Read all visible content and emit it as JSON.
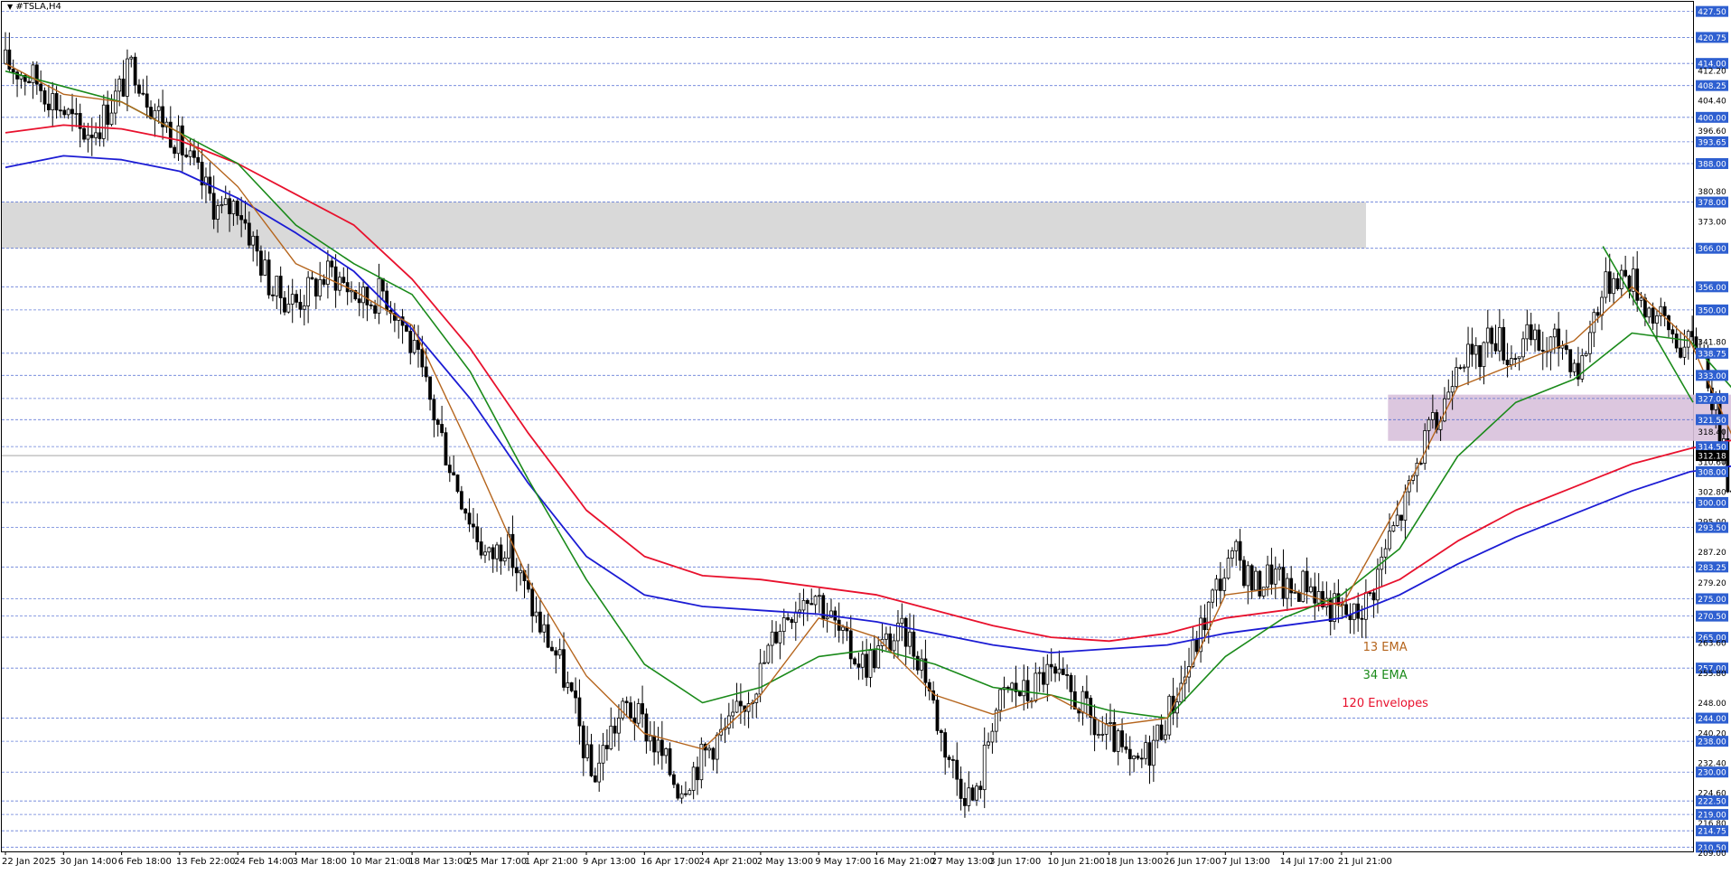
{
  "window": {
    "symbol_title": "#TSLA,H4",
    "current_price": "312.18"
  },
  "colors": {
    "background": "#ffffff",
    "bull_body": "#ffffff",
    "bear_body": "#000000",
    "candle_outline": "#000000",
    "ema13": "#b5651d",
    "ema34": "#1a8a1a",
    "env_upper": "#e8112d",
    "env_lower": "#1c1cd4",
    "trendline": "#1a8a1a",
    "resistance_zone": "#d9d9d9",
    "pivot_zone": "#d8c1dc",
    "level_line": "#3355cc",
    "price_tag_bg": "#2e5fd0",
    "current_tag_bg": "#000000"
  },
  "chart_data": {
    "type": "candlestick",
    "title": "#TSLA,H4",
    "ylim": [
      209.4,
      430
    ],
    "x_tick_labels": [
      "22 Jan 2025",
      "30 Jan 14:00",
      "6 Feb 18:00",
      "13 Feb 22:00",
      "24 Feb 14:00",
      "3 Mar 18:00",
      "10 Mar 21:00",
      "18 Mar 13:00",
      "25 Mar 17:00",
      "1 Apr 21:00",
      "9 Apr 13:00",
      "16 Apr 17:00",
      "24 Apr 21:00",
      "2 May 13:00",
      "9 May 17:00",
      "16 May 21:00",
      "27 May 13:00",
      "3 Jun 17:00",
      "10 Jun 21:00",
      "18 Jun 13:00",
      "26 Jun 17:00",
      "7 Jul 13:00",
      "14 Jul 17:00",
      "21 Jul 21:00"
    ],
    "y_tick_labels": [
      "427.50",
      "420.75",
      "414.00",
      "412.20",
      "408.25",
      "404.40",
      "400.00",
      "396.60",
      "393.65",
      "388.00",
      "380.80",
      "378.00",
      "373.00",
      "366.00",
      "356.00",
      "350.00",
      "341.80",
      "338.75",
      "333.00",
      "327.00",
      "321.50",
      "318.40",
      "314.50",
      "310.60",
      "308.00",
      "302.80",
      "300.00",
      "295.00",
      "293.50",
      "287.20",
      "283.25",
      "279.20",
      "275.00",
      "270.50",
      "265.00",
      "263.60",
      "257.00",
      "255.80",
      "248.00",
      "244.00",
      "240.20",
      "238.00",
      "232.40",
      "230.00",
      "224.60",
      "222.50",
      "216.80",
      "219.00",
      "214.75",
      "210.50",
      "209.00"
    ],
    "horizontal_levels": [
      427.5,
      420.75,
      414.0,
      408.25,
      400.0,
      393.65,
      388.0,
      378.0,
      366.0,
      356.0,
      350.0,
      338.75,
      333.0,
      327.0,
      321.5,
      314.5,
      308.0,
      300.0,
      293.5,
      283.25,
      275.0,
      270.5,
      265.0,
      257.0,
      244.0,
      238.0,
      230.0,
      222.5,
      219.0,
      214.75,
      210.5
    ],
    "resistance_zone": [
      366.0,
      378.0
    ],
    "pivot_zone": [
      316.0,
      328.0
    ],
    "trendline": {
      "from": {
        "x_index": 27.5,
        "y": 366.5
      },
      "to": {
        "x_index": 50,
        "y": 326.0
      }
    },
    "annotations": [
      "13 EMA",
      "34 EMA",
      "120 Envelopes"
    ],
    "close_path": [
      [
        0,
        414
      ],
      [
        0.5,
        410
      ],
      [
        1,
        402
      ],
      [
        1.3,
        396
      ],
      [
        1.6,
        398
      ],
      [
        2,
        408
      ],
      [
        2.2,
        414
      ],
      [
        2.5,
        404
      ],
      [
        3,
        393
      ],
      [
        3.3,
        385
      ],
      [
        3.7,
        375
      ],
      [
        4,
        378
      ],
      [
        4.3,
        366
      ],
      [
        4.6,
        355
      ],
      [
        5,
        352
      ],
      [
        5.3,
        356
      ],
      [
        5.6,
        360
      ],
      [
        5.9,
        356
      ],
      [
        6.2,
        352
      ],
      [
        6.5,
        355
      ],
      [
        6.8,
        348
      ],
      [
        7.1,
        336
      ],
      [
        7.4,
        322
      ],
      [
        7.7,
        308
      ],
      [
        8,
        296
      ],
      [
        8.3,
        285
      ],
      [
        8.6,
        290
      ],
      [
        8.9,
        279
      ],
      [
        9.2,
        268
      ],
      [
        9.5,
        260
      ],
      [
        9.8,
        246
      ],
      [
        10.1,
        228
      ],
      [
        10.4,
        240
      ],
      [
        10.7,
        247
      ],
      [
        11,
        242
      ],
      [
        11.3,
        234
      ],
      [
        11.6,
        226
      ],
      [
        11.9,
        232
      ],
      [
        12.2,
        238
      ],
      [
        12.5,
        242
      ],
      [
        13,
        256
      ],
      [
        13.3,
        268
      ],
      [
        13.6,
        274
      ],
      [
        13.9,
        278
      ],
      [
        14.2,
        270
      ],
      [
        14.5,
        262
      ],
      [
        14.8,
        258
      ],
      [
        15.2,
        264
      ],
      [
        15.5,
        266
      ],
      [
        15.8,
        258
      ],
      [
        16.1,
        240
      ],
      [
        16.4,
        228
      ],
      [
        16.7,
        222
      ],
      [
        17,
        245
      ],
      [
        17.3,
        252
      ],
      [
        17.6,
        250
      ],
      [
        17.9,
        256
      ],
      [
        18.2,
        252
      ],
      [
        18.5,
        248
      ],
      [
        18.8,
        240
      ],
      [
        19.1,
        238
      ],
      [
        19.4,
        230
      ],
      [
        19.7,
        236
      ],
      [
        20,
        245
      ],
      [
        20.3,
        255
      ],
      [
        20.6,
        268
      ],
      [
        20.9,
        280
      ],
      [
        21.2,
        286
      ],
      [
        21.5,
        278
      ],
      [
        21.8,
        282
      ],
      [
        22.1,
        276
      ],
      [
        22.4,
        280
      ],
      [
        22.7,
        274
      ],
      [
        23.2,
        270
      ],
      [
        23.5,
        276
      ],
      [
        23.8,
        290
      ],
      [
        24.1,
        300
      ],
      [
        24.4,
        315
      ],
      [
        24.7,
        322
      ],
      [
        25,
        340
      ],
      [
        25.3,
        336
      ],
      [
        25.6,
        345
      ],
      [
        25.9,
        338
      ],
      [
        26.2,
        342
      ],
      [
        26.5,
        340
      ],
      [
        26.8,
        342
      ],
      [
        27.1,
        334
      ],
      [
        27.4,
        352
      ],
      [
        27.7,
        360
      ],
      [
        28,
        358
      ],
      [
        28.3,
        350
      ],
      [
        28.6,
        346
      ],
      [
        28.9,
        340
      ],
      [
        29.2,
        342
      ],
      [
        29.5,
        318
      ],
      [
        29.8,
        296
      ],
      [
        30,
        285
      ],
      [
        30.2,
        300
      ],
      [
        30.5,
        318
      ],
      [
        30.8,
        322
      ],
      [
        31.1,
        326
      ],
      [
        31.4,
        318
      ],
      [
        31.7,
        320
      ],
      [
        32,
        322
      ],
      [
        32.3,
        318
      ],
      [
        32.6,
        320
      ],
      [
        32.9,
        327
      ],
      [
        33.2,
        352
      ],
      [
        33.5,
        346
      ],
      [
        33.8,
        330
      ],
      [
        34.1,
        326
      ],
      [
        34.4,
        323
      ],
      [
        34.7,
        320
      ],
      [
        35,
        318
      ],
      [
        35.3,
        312
      ],
      [
        35.6,
        296
      ],
      [
        35.9,
        306
      ],
      [
        36.2,
        300
      ],
      [
        36.5,
        296
      ],
      [
        36.8,
        298
      ],
      [
        37.1,
        306
      ],
      [
        37.4,
        312
      ],
      [
        37.7,
        316
      ],
      [
        38,
        314
      ],
      [
        38.3,
        318
      ],
      [
        38.6,
        320
      ],
      [
        38.9,
        326
      ],
      [
        39.2,
        332
      ],
      [
        39.5,
        330
      ],
      [
        39.8,
        326
      ]
    ],
    "ema13": [
      [
        0,
        414
      ],
      [
        1,
        406
      ],
      [
        2,
        404
      ],
      [
        3,
        396
      ],
      [
        4,
        382
      ],
      [
        5,
        362
      ],
      [
        6,
        355
      ],
      [
        7,
        346
      ],
      [
        8,
        314
      ],
      [
        9,
        280
      ],
      [
        10,
        255
      ],
      [
        11,
        240
      ],
      [
        12,
        236
      ],
      [
        13,
        250
      ],
      [
        14,
        270
      ],
      [
        15,
        265
      ],
      [
        16,
        250
      ],
      [
        17,
        245
      ],
      [
        18,
        250
      ],
      [
        19,
        242
      ],
      [
        20,
        244
      ],
      [
        21,
        276
      ],
      [
        22,
        278
      ],
      [
        23,
        273
      ],
      [
        24,
        300
      ],
      [
        25,
        330
      ],
      [
        26,
        336
      ],
      [
        27,
        342
      ],
      [
        28,
        356
      ],
      [
        29,
        342
      ],
      [
        30,
        308
      ],
      [
        31,
        318
      ],
      [
        32,
        322
      ],
      [
        33,
        335
      ],
      [
        34,
        328
      ],
      [
        35,
        320
      ],
      [
        36,
        300
      ],
      [
        37,
        305
      ],
      [
        38,
        314
      ],
      [
        39,
        322
      ],
      [
        39.8,
        326
      ]
    ],
    "ema34": [
      [
        0,
        412
      ],
      [
        1,
        408
      ],
      [
        2,
        404
      ],
      [
        3,
        396
      ],
      [
        4,
        388
      ],
      [
        5,
        372
      ],
      [
        6,
        362
      ],
      [
        7,
        354
      ],
      [
        8,
        334
      ],
      [
        9,
        306
      ],
      [
        10,
        280
      ],
      [
        11,
        258
      ],
      [
        12,
        248
      ],
      [
        13,
        252
      ],
      [
        14,
        260
      ],
      [
        15,
        262
      ],
      [
        16,
        258
      ],
      [
        17,
        252
      ],
      [
        18,
        250
      ],
      [
        19,
        246
      ],
      [
        20,
        244
      ],
      [
        21,
        260
      ],
      [
        22,
        270
      ],
      [
        23,
        276
      ],
      [
        24,
        288
      ],
      [
        25,
        312
      ],
      [
        26,
        326
      ],
      [
        27,
        332
      ],
      [
        28,
        344
      ],
      [
        29,
        342
      ],
      [
        30,
        325
      ],
      [
        31,
        321
      ],
      [
        32,
        321
      ],
      [
        33,
        326
      ],
      [
        34,
        324
      ],
      [
        35,
        320
      ],
      [
        36,
        312
      ],
      [
        37,
        310
      ],
      [
        38,
        312
      ],
      [
        39,
        318
      ],
      [
        39.8,
        320
      ]
    ],
    "env_upper": [
      [
        0,
        396
      ],
      [
        1,
        398
      ],
      [
        2,
        397
      ],
      [
        3,
        394
      ],
      [
        4,
        388
      ],
      [
        5,
        380
      ],
      [
        6,
        372
      ],
      [
        7,
        358
      ],
      [
        8,
        340
      ],
      [
        9,
        318
      ],
      [
        10,
        298
      ],
      [
        11,
        286
      ],
      [
        12,
        281
      ],
      [
        13,
        280
      ],
      [
        14,
        278
      ],
      [
        15,
        276
      ],
      [
        16,
        272
      ],
      [
        17,
        268
      ],
      [
        18,
        265
      ],
      [
        19,
        264
      ],
      [
        20,
        266
      ],
      [
        21,
        270
      ],
      [
        22,
        272
      ],
      [
        23,
        274
      ],
      [
        24,
        280
      ],
      [
        25,
        290
      ],
      [
        26,
        298
      ],
      [
        27,
        304
      ],
      [
        28,
        310
      ],
      [
        29,
        314
      ],
      [
        30,
        317
      ],
      [
        31,
        318
      ],
      [
        32,
        318
      ],
      [
        33,
        319
      ],
      [
        34,
        319
      ],
      [
        35,
        318
      ],
      [
        36,
        317
      ],
      [
        37,
        316
      ],
      [
        38,
        317
      ],
      [
        39,
        318
      ],
      [
        39.8,
        320
      ]
    ],
    "env_lower": [
      [
        0,
        387
      ],
      [
        1,
        390
      ],
      [
        2,
        389
      ],
      [
        3,
        386
      ],
      [
        4,
        379
      ],
      [
        5,
        370
      ],
      [
        6,
        360
      ],
      [
        7,
        345
      ],
      [
        8,
        327
      ],
      [
        9,
        305
      ],
      [
        10,
        286
      ],
      [
        11,
        276
      ],
      [
        12,
        273
      ],
      [
        13,
        272
      ],
      [
        14,
        271
      ],
      [
        15,
        269
      ],
      [
        16,
        266
      ],
      [
        17,
        263
      ],
      [
        18,
        261
      ],
      [
        19,
        262
      ],
      [
        20,
        263
      ],
      [
        21,
        266
      ],
      [
        22,
        268
      ],
      [
        23,
        270
      ],
      [
        24,
        276
      ],
      [
        25,
        284
      ],
      [
        26,
        291
      ],
      [
        27,
        297
      ],
      [
        28,
        303
      ],
      [
        29,
        308
      ],
      [
        30,
        310
      ],
      [
        31,
        311
      ],
      [
        32,
        312
      ],
      [
        33,
        313
      ],
      [
        34,
        313
      ],
      [
        35,
        312
      ],
      [
        36,
        311
      ],
      [
        37,
        310
      ],
      [
        38,
        311
      ],
      [
        39,
        312
      ],
      [
        39.8,
        314
      ]
    ]
  }
}
